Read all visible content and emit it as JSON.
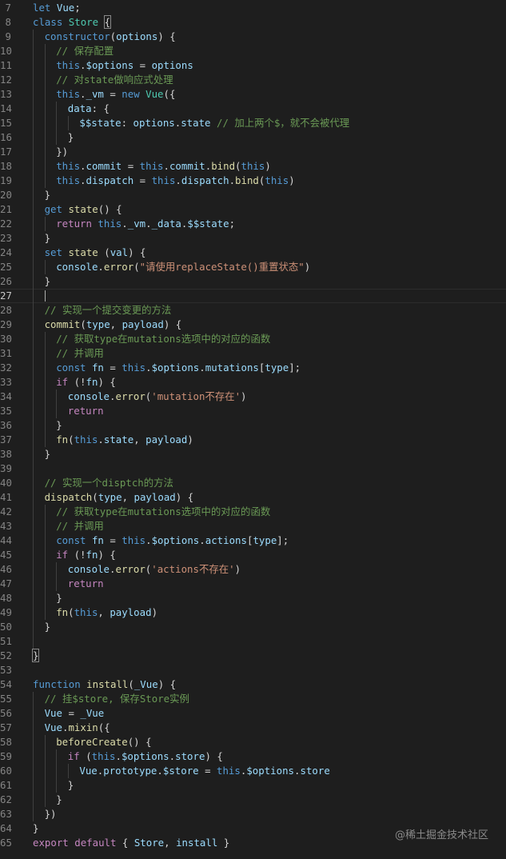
{
  "lines": [
    {
      "n": "7",
      "indent": 0,
      "tokens": [
        [
          "kw",
          "let"
        ],
        [
          "pl",
          " "
        ],
        [
          "var",
          "Vue"
        ],
        [
          "pl",
          ";"
        ]
      ]
    },
    {
      "n": "8",
      "indent": 0,
      "tokens": [
        [
          "kw",
          "class"
        ],
        [
          "pl",
          " "
        ],
        [
          "cls",
          "Store"
        ],
        [
          "pl",
          " "
        ],
        [
          "brm",
          "{"
        ]
      ]
    },
    {
      "n": "9",
      "indent": 1,
      "tokens": [
        [
          "kw",
          "constructor"
        ],
        [
          "br",
          "("
        ],
        [
          "var",
          "options"
        ],
        [
          "br",
          ")"
        ],
        [
          "pl",
          " {"
        ]
      ]
    },
    {
      "n": "10",
      "indent": 2,
      "tokens": [
        [
          "cmt",
          "// 保存配置"
        ]
      ]
    },
    {
      "n": "11",
      "indent": 2,
      "tokens": [
        [
          "kw",
          "this"
        ],
        [
          "pl",
          "."
        ],
        [
          "var",
          "$options"
        ],
        [
          "pl",
          " = "
        ],
        [
          "var",
          "options"
        ]
      ]
    },
    {
      "n": "12",
      "indent": 2,
      "tokens": [
        [
          "cmt",
          "// 对state做响应式处理"
        ]
      ]
    },
    {
      "n": "13",
      "indent": 2,
      "tokens": [
        [
          "kw",
          "this"
        ],
        [
          "pl",
          "."
        ],
        [
          "var",
          "_vm"
        ],
        [
          "pl",
          " = "
        ],
        [
          "kw",
          "new"
        ],
        [
          "pl",
          " "
        ],
        [
          "cls",
          "Vue"
        ],
        [
          "br",
          "({"
        ]
      ]
    },
    {
      "n": "14",
      "indent": 3,
      "tokens": [
        [
          "var",
          "data"
        ],
        [
          "pl",
          ": {"
        ]
      ]
    },
    {
      "n": "15",
      "indent": 4,
      "tokens": [
        [
          "var",
          "$$state"
        ],
        [
          "pl",
          ": "
        ],
        [
          "var",
          "options"
        ],
        [
          "pl",
          "."
        ],
        [
          "var",
          "state"
        ],
        [
          "pl",
          " "
        ],
        [
          "cmt",
          "// 加上两个$，就不会被代理"
        ]
      ]
    },
    {
      "n": "16",
      "indent": 3,
      "tokens": [
        [
          "pl",
          "}"
        ]
      ]
    },
    {
      "n": "17",
      "indent": 2,
      "tokens": [
        [
          "br",
          "})"
        ]
      ]
    },
    {
      "n": "18",
      "indent": 2,
      "tokens": [
        [
          "kw",
          "this"
        ],
        [
          "pl",
          "."
        ],
        [
          "var",
          "commit"
        ],
        [
          "pl",
          " = "
        ],
        [
          "kw",
          "this"
        ],
        [
          "pl",
          "."
        ],
        [
          "var",
          "commit"
        ],
        [
          "pl",
          "."
        ],
        [
          "fn",
          "bind"
        ],
        [
          "br",
          "("
        ],
        [
          "kw",
          "this"
        ],
        [
          "br",
          ")"
        ]
      ]
    },
    {
      "n": "19",
      "indent": 2,
      "tokens": [
        [
          "kw",
          "this"
        ],
        [
          "pl",
          "."
        ],
        [
          "var",
          "dispatch"
        ],
        [
          "pl",
          " = "
        ],
        [
          "kw",
          "this"
        ],
        [
          "pl",
          "."
        ],
        [
          "var",
          "dispatch"
        ],
        [
          "pl",
          "."
        ],
        [
          "fn",
          "bind"
        ],
        [
          "br",
          "("
        ],
        [
          "kw",
          "this"
        ],
        [
          "br",
          ")"
        ]
      ]
    },
    {
      "n": "20",
      "indent": 1,
      "tokens": [
        [
          "pl",
          "}"
        ]
      ]
    },
    {
      "n": "21",
      "indent": 1,
      "tokens": [
        [
          "kw",
          "get"
        ],
        [
          "pl",
          " "
        ],
        [
          "fn",
          "state"
        ],
        [
          "br",
          "()"
        ],
        [
          "pl",
          " {"
        ]
      ]
    },
    {
      "n": "22",
      "indent": 2,
      "tokens": [
        [
          "ctl",
          "return"
        ],
        [
          "pl",
          " "
        ],
        [
          "kw",
          "this"
        ],
        [
          "pl",
          "."
        ],
        [
          "var",
          "_vm"
        ],
        [
          "pl",
          "."
        ],
        [
          "var",
          "_data"
        ],
        [
          "pl",
          "."
        ],
        [
          "var",
          "$$state"
        ],
        [
          "pl",
          ";"
        ]
      ]
    },
    {
      "n": "23",
      "indent": 1,
      "tokens": [
        [
          "pl",
          "}"
        ]
      ]
    },
    {
      "n": "24",
      "indent": 1,
      "tokens": [
        [
          "kw",
          "set"
        ],
        [
          "pl",
          " "
        ],
        [
          "fn",
          "state"
        ],
        [
          "pl",
          " "
        ],
        [
          "br",
          "("
        ],
        [
          "var",
          "val"
        ],
        [
          "br",
          ")"
        ],
        [
          "pl",
          " {"
        ]
      ]
    },
    {
      "n": "25",
      "indent": 2,
      "tokens": [
        [
          "var",
          "console"
        ],
        [
          "pl",
          "."
        ],
        [
          "fn",
          "error"
        ],
        [
          "br",
          "("
        ],
        [
          "str",
          "\"请使用replaceState()重置状态\""
        ],
        [
          "br",
          ")"
        ]
      ]
    },
    {
      "n": "26",
      "indent": 1,
      "tokens": [
        [
          "pl",
          "}"
        ]
      ]
    },
    {
      "n": "27",
      "indent": 1,
      "tokens": [],
      "current": true
    },
    {
      "n": "28",
      "indent": 1,
      "tokens": [
        [
          "cmt",
          "// 实现一个提交变更的方法"
        ]
      ]
    },
    {
      "n": "29",
      "indent": 1,
      "tokens": [
        [
          "fn",
          "commit"
        ],
        [
          "br",
          "("
        ],
        [
          "var",
          "type"
        ],
        [
          "pl",
          ", "
        ],
        [
          "var",
          "payload"
        ],
        [
          "br",
          ")"
        ],
        [
          "pl",
          " {"
        ]
      ]
    },
    {
      "n": "30",
      "indent": 2,
      "tokens": [
        [
          "cmt",
          "// 获取type在mutations选项中的对应的函数"
        ]
      ]
    },
    {
      "n": "31",
      "indent": 2,
      "tokens": [
        [
          "cmt",
          "// 并调用"
        ]
      ]
    },
    {
      "n": "32",
      "indent": 2,
      "tokens": [
        [
          "kw",
          "const"
        ],
        [
          "pl",
          " "
        ],
        [
          "var",
          "fn"
        ],
        [
          "pl",
          " = "
        ],
        [
          "kw",
          "this"
        ],
        [
          "pl",
          "."
        ],
        [
          "var",
          "$options"
        ],
        [
          "pl",
          "."
        ],
        [
          "var",
          "mutations"
        ],
        [
          "br",
          "["
        ],
        [
          "var",
          "type"
        ],
        [
          "br",
          "]"
        ],
        [
          "pl",
          ";"
        ]
      ]
    },
    {
      "n": "33",
      "indent": 2,
      "tokens": [
        [
          "ctl",
          "if"
        ],
        [
          "pl",
          " "
        ],
        [
          "br",
          "("
        ],
        [
          "pl",
          "!"
        ],
        [
          "var",
          "fn"
        ],
        [
          "br",
          ")"
        ],
        [
          "pl",
          " {"
        ]
      ]
    },
    {
      "n": "34",
      "indent": 3,
      "tokens": [
        [
          "var",
          "console"
        ],
        [
          "pl",
          "."
        ],
        [
          "fn",
          "error"
        ],
        [
          "br",
          "("
        ],
        [
          "str",
          "'mutation不存在'"
        ],
        [
          "br",
          ")"
        ]
      ]
    },
    {
      "n": "35",
      "indent": 3,
      "tokens": [
        [
          "ctl",
          "return"
        ]
      ]
    },
    {
      "n": "36",
      "indent": 2,
      "tokens": [
        [
          "pl",
          "}"
        ]
      ]
    },
    {
      "n": "37",
      "indent": 2,
      "tokens": [
        [
          "fn",
          "fn"
        ],
        [
          "br",
          "("
        ],
        [
          "kw",
          "this"
        ],
        [
          "pl",
          "."
        ],
        [
          "var",
          "state"
        ],
        [
          "pl",
          ", "
        ],
        [
          "var",
          "payload"
        ],
        [
          "br",
          ")"
        ]
      ]
    },
    {
      "n": "38",
      "indent": 1,
      "tokens": [
        [
          "pl",
          "}"
        ]
      ]
    },
    {
      "n": "39",
      "indent": 1,
      "tokens": []
    },
    {
      "n": "40",
      "indent": 1,
      "tokens": [
        [
          "cmt",
          "// 实现一个disptch的方法"
        ]
      ]
    },
    {
      "n": "41",
      "indent": 1,
      "tokens": [
        [
          "fn",
          "dispatch"
        ],
        [
          "br",
          "("
        ],
        [
          "var",
          "type"
        ],
        [
          "pl",
          ", "
        ],
        [
          "var",
          "payload"
        ],
        [
          "br",
          ")"
        ],
        [
          "pl",
          " {"
        ]
      ]
    },
    {
      "n": "42",
      "indent": 2,
      "tokens": [
        [
          "cmt",
          "// 获取type在mutations选项中的对应的函数"
        ]
      ]
    },
    {
      "n": "43",
      "indent": 2,
      "tokens": [
        [
          "cmt",
          "// 并调用"
        ]
      ]
    },
    {
      "n": "44",
      "indent": 2,
      "tokens": [
        [
          "kw",
          "const"
        ],
        [
          "pl",
          " "
        ],
        [
          "var",
          "fn"
        ],
        [
          "pl",
          " = "
        ],
        [
          "kw",
          "this"
        ],
        [
          "pl",
          "."
        ],
        [
          "var",
          "$options"
        ],
        [
          "pl",
          "."
        ],
        [
          "var",
          "actions"
        ],
        [
          "br",
          "["
        ],
        [
          "var",
          "type"
        ],
        [
          "br",
          "]"
        ],
        [
          "pl",
          ";"
        ]
      ]
    },
    {
      "n": "45",
      "indent": 2,
      "tokens": [
        [
          "ctl",
          "if"
        ],
        [
          "pl",
          " "
        ],
        [
          "br",
          "("
        ],
        [
          "pl",
          "!"
        ],
        [
          "var",
          "fn"
        ],
        [
          "br",
          ")"
        ],
        [
          "pl",
          " {"
        ]
      ]
    },
    {
      "n": "46",
      "indent": 3,
      "tokens": [
        [
          "var",
          "console"
        ],
        [
          "pl",
          "."
        ],
        [
          "fn",
          "error"
        ],
        [
          "br",
          "("
        ],
        [
          "str",
          "'actions不存在'"
        ],
        [
          "br",
          ")"
        ]
      ]
    },
    {
      "n": "47",
      "indent": 3,
      "tokens": [
        [
          "ctl",
          "return"
        ]
      ]
    },
    {
      "n": "48",
      "indent": 2,
      "tokens": [
        [
          "pl",
          "}"
        ]
      ]
    },
    {
      "n": "49",
      "indent": 2,
      "tokens": [
        [
          "fn",
          "fn"
        ],
        [
          "br",
          "("
        ],
        [
          "kw",
          "this"
        ],
        [
          "pl",
          ", "
        ],
        [
          "var",
          "payload"
        ],
        [
          "br",
          ")"
        ]
      ]
    },
    {
      "n": "50",
      "indent": 1,
      "tokens": [
        [
          "pl",
          "}"
        ]
      ]
    },
    {
      "n": "51",
      "indent": 1,
      "tokens": []
    },
    {
      "n": "52",
      "indent": 0,
      "tokens": [
        [
          "brm",
          "}"
        ]
      ]
    },
    {
      "n": "53",
      "indent": 0,
      "tokens": []
    },
    {
      "n": "54",
      "indent": 0,
      "tokens": [
        [
          "kw",
          "function"
        ],
        [
          "pl",
          " "
        ],
        [
          "fn",
          "install"
        ],
        [
          "br",
          "("
        ],
        [
          "var",
          "_Vue"
        ],
        [
          "br",
          ")"
        ],
        [
          "pl",
          " {"
        ]
      ]
    },
    {
      "n": "55",
      "indent": 1,
      "tokens": [
        [
          "cmt",
          "// 挂$store, 保存Store实例"
        ]
      ]
    },
    {
      "n": "56",
      "indent": 1,
      "tokens": [
        [
          "var",
          "Vue"
        ],
        [
          "pl",
          " = "
        ],
        [
          "var",
          "_Vue"
        ]
      ]
    },
    {
      "n": "57",
      "indent": 1,
      "tokens": [
        [
          "var",
          "Vue"
        ],
        [
          "pl",
          "."
        ],
        [
          "fn",
          "mixin"
        ],
        [
          "br",
          "({"
        ]
      ]
    },
    {
      "n": "58",
      "indent": 2,
      "tokens": [
        [
          "fn",
          "beforeCreate"
        ],
        [
          "br",
          "()"
        ],
        [
          "pl",
          " {"
        ]
      ]
    },
    {
      "n": "59",
      "indent": 3,
      "tokens": [
        [
          "ctl",
          "if"
        ],
        [
          "pl",
          " "
        ],
        [
          "br",
          "("
        ],
        [
          "kw",
          "this"
        ],
        [
          "pl",
          "."
        ],
        [
          "var",
          "$options"
        ],
        [
          "pl",
          "."
        ],
        [
          "var",
          "store"
        ],
        [
          "br",
          ")"
        ],
        [
          "pl",
          " {"
        ]
      ]
    },
    {
      "n": "60",
      "indent": 4,
      "tokens": [
        [
          "var",
          "Vue"
        ],
        [
          "pl",
          "."
        ],
        [
          "var",
          "prototype"
        ],
        [
          "pl",
          "."
        ],
        [
          "var",
          "$store"
        ],
        [
          "pl",
          " = "
        ],
        [
          "kw",
          "this"
        ],
        [
          "pl",
          "."
        ],
        [
          "var",
          "$options"
        ],
        [
          "pl",
          "."
        ],
        [
          "var",
          "store"
        ]
      ]
    },
    {
      "n": "61",
      "indent": 3,
      "tokens": [
        [
          "pl",
          "}"
        ]
      ]
    },
    {
      "n": "62",
      "indent": 2,
      "tokens": [
        [
          "pl",
          "}"
        ]
      ]
    },
    {
      "n": "63",
      "indent": 1,
      "tokens": [
        [
          "br",
          "})"
        ]
      ]
    },
    {
      "n": "64",
      "indent": 0,
      "tokens": [
        [
          "pl",
          "}"
        ]
      ]
    },
    {
      "n": "65",
      "indent": 0,
      "tokens": [
        [
          "ctl",
          "export"
        ],
        [
          "pl",
          " "
        ],
        [
          "ctl",
          "default"
        ],
        [
          "pl",
          " { "
        ],
        [
          "var",
          "Store"
        ],
        [
          "pl",
          ", "
        ],
        [
          "var",
          "install"
        ],
        [
          "pl",
          " }"
        ]
      ]
    }
  ],
  "watermark": "@稀土掘金技术社区",
  "colors": {
    "background": "#1e1e1e",
    "keyword": "#569cd6",
    "control": "#c586c0",
    "class": "#4ec9b0",
    "function": "#dcdcaa",
    "variable": "#9cdcfe",
    "string": "#ce9178",
    "comment": "#6a9955",
    "line_number": "#858585"
  }
}
